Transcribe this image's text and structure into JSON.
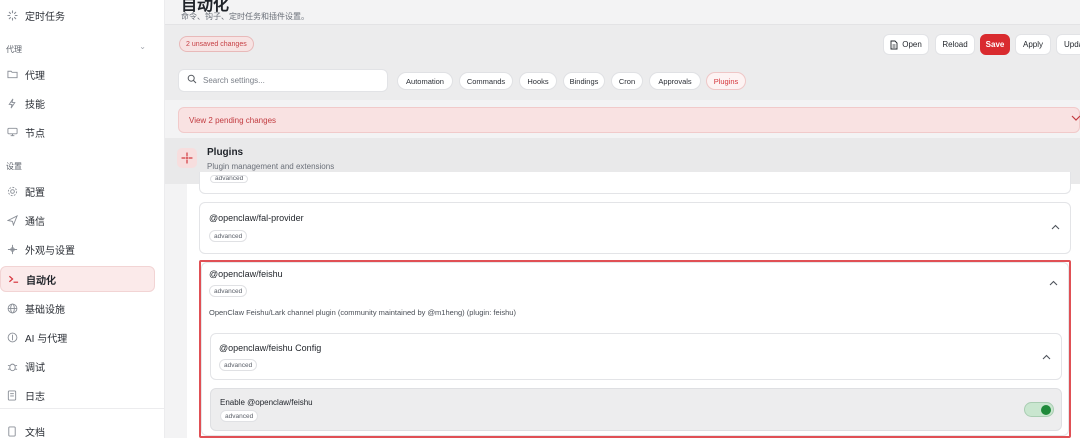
{
  "sidebar": {
    "top_item": {
      "label": "定时任务",
      "icon": "loader-icon"
    },
    "sections": [
      {
        "label": "代理",
        "chevron": "⌄"
      },
      {
        "label": "设置"
      }
    ],
    "agent_items": [
      {
        "label": "代理",
        "icon": "folder-icon"
      },
      {
        "label": "技能",
        "icon": "lightning-icon"
      },
      {
        "label": "节点",
        "icon": "monitor-icon"
      }
    ],
    "settings_items": [
      {
        "label": "配置",
        "icon": "gear-icon"
      },
      {
        "label": "通信",
        "icon": "send-icon"
      },
      {
        "label": "外观与设置",
        "icon": "sparkle-icon"
      },
      {
        "label": "自动化",
        "icon": "terminal-icon"
      },
      {
        "label": "基础设施",
        "icon": "globe-icon"
      },
      {
        "label": "AI 与代理",
        "icon": "robot-icon"
      },
      {
        "label": "调试",
        "icon": "bug-icon"
      },
      {
        "label": "日志",
        "icon": "log-icon"
      }
    ],
    "footer_item": {
      "label": "文档",
      "icon": "book-icon"
    },
    "accent": "#d7373f"
  },
  "header": {
    "title": "自动化",
    "subtitle": "命令、钩子、定时任务和插件设置。"
  },
  "toolbar": {
    "unsaved_badge": "2 unsaved changes",
    "open_label": "Open",
    "reload_label": "Reload",
    "save_label": "Save",
    "apply_label": "Apply",
    "update_label": "Update",
    "save_color": "#d92b2f"
  },
  "search": {
    "placeholder": "Search settings..."
  },
  "tabs": [
    {
      "label": "Automation"
    },
    {
      "label": "Commands"
    },
    {
      "label": "Hooks"
    },
    {
      "label": "Bindings"
    },
    {
      "label": "Cron"
    },
    {
      "label": "Approvals"
    },
    {
      "label": "Plugins",
      "active": true
    }
  ],
  "pending": {
    "label": "View 2 pending changes"
  },
  "section": {
    "title": "Plugins",
    "subtitle": "Plugin management and extensions",
    "icon": "plug-icon"
  },
  "plugins": {
    "prev_chip": "advanced",
    "fal": {
      "name": "@openclaw/fal-provider",
      "chip": "advanced"
    },
    "feishu": {
      "name": "@openclaw/feishu",
      "chip": "advanced",
      "description": "OpenClaw Feishu/Lark channel plugin (community maintained by @m1heng) (plugin: feishu)",
      "config": {
        "title": "@openclaw/feishu Config",
        "chip": "advanced"
      },
      "enable": {
        "label": "Enable @openclaw/feishu",
        "chip": "advanced",
        "enabled": true,
        "toggle_color": "#1f8a3a"
      }
    }
  }
}
